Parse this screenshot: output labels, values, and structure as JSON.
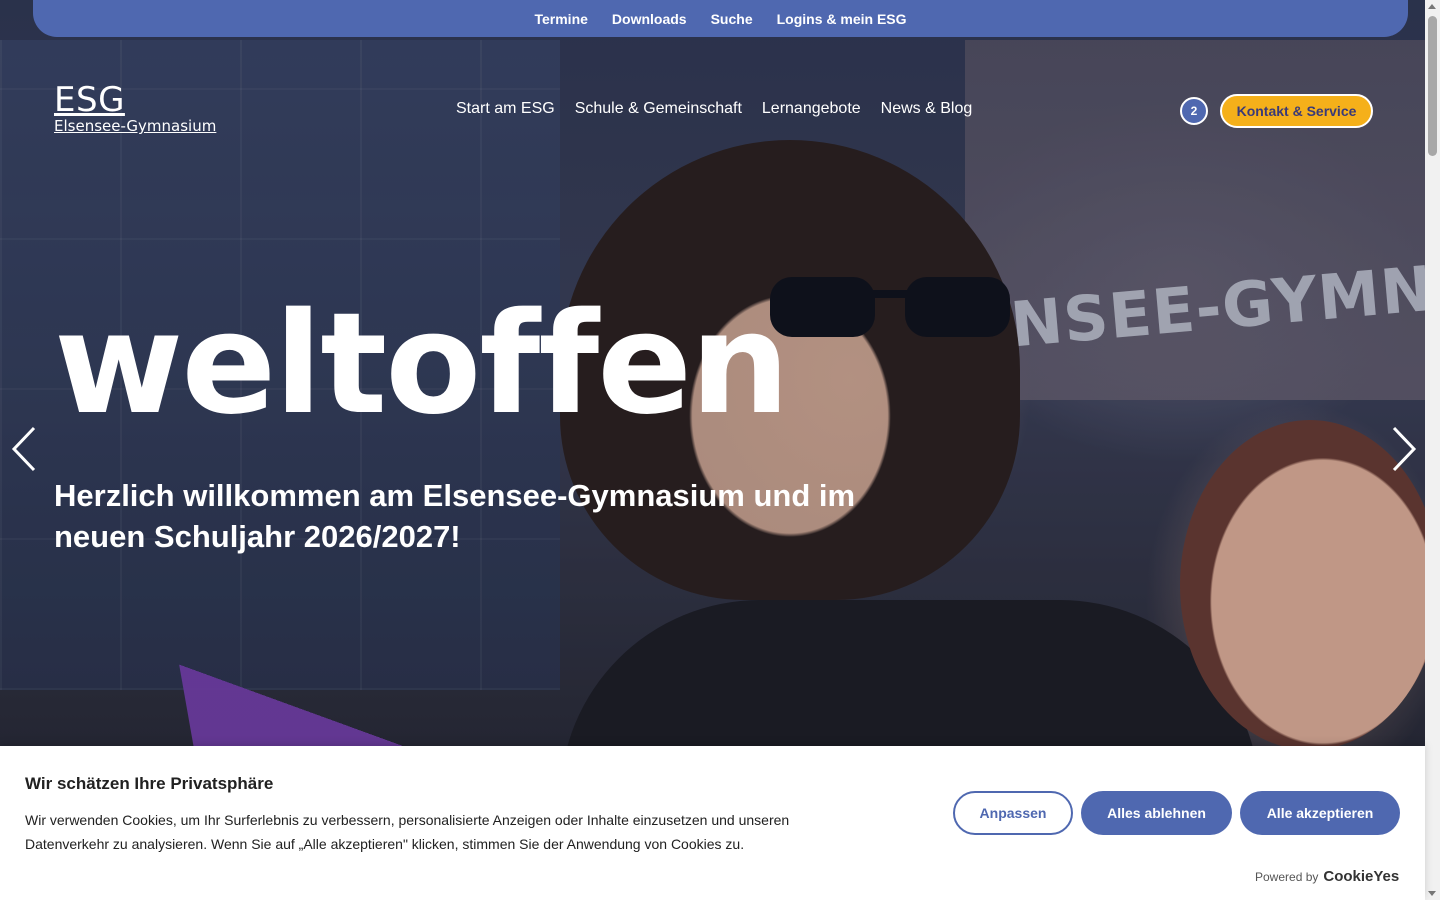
{
  "topbar": {
    "links": [
      "Termine",
      "Downloads",
      "Suche",
      "Logins & mein ESG"
    ]
  },
  "logo": {
    "abbr": "ESG",
    "full": "Elsensee-Gymnasium"
  },
  "nav": {
    "items": [
      "Start am ESG",
      "Schule & Gemeinschaft",
      "Lernangebote",
      "News & Blog"
    ]
  },
  "badge": {
    "count": "2"
  },
  "kontakt": {
    "label": "Kontakt & Service"
  },
  "hero": {
    "title": "weltoffen",
    "subtitle": "Herzlich willkommen am Elsensee-Gymnasium und im neuen Schuljahr 2026/2027!",
    "sign_text": "NSEE-GYMNA"
  },
  "cookie": {
    "title": "Wir schätzen Ihre Privatsphäre",
    "text": "Wir verwenden Cookies, um Ihr Surferlebnis zu verbessern, personalisierte Anzeigen oder Inhalte einzusetzen und unseren Datenverkehr zu analysieren. Wenn Sie auf „Alle akzeptieren\" klicken, stimmen Sie der Anwendung von Cookies zu.",
    "customize_label": "Anpassen",
    "reject_label": "Alles ablehnen",
    "accept_label": "Alle akzeptieren",
    "powered_by": "Powered by",
    "brand": "CookieYes"
  },
  "colors": {
    "primary": "#4f68b0",
    "accent": "#f5b01a",
    "accent_text": "#3a3a78"
  },
  "icons": {
    "prev": "chevron-left-icon",
    "next": "chevron-right-icon"
  }
}
